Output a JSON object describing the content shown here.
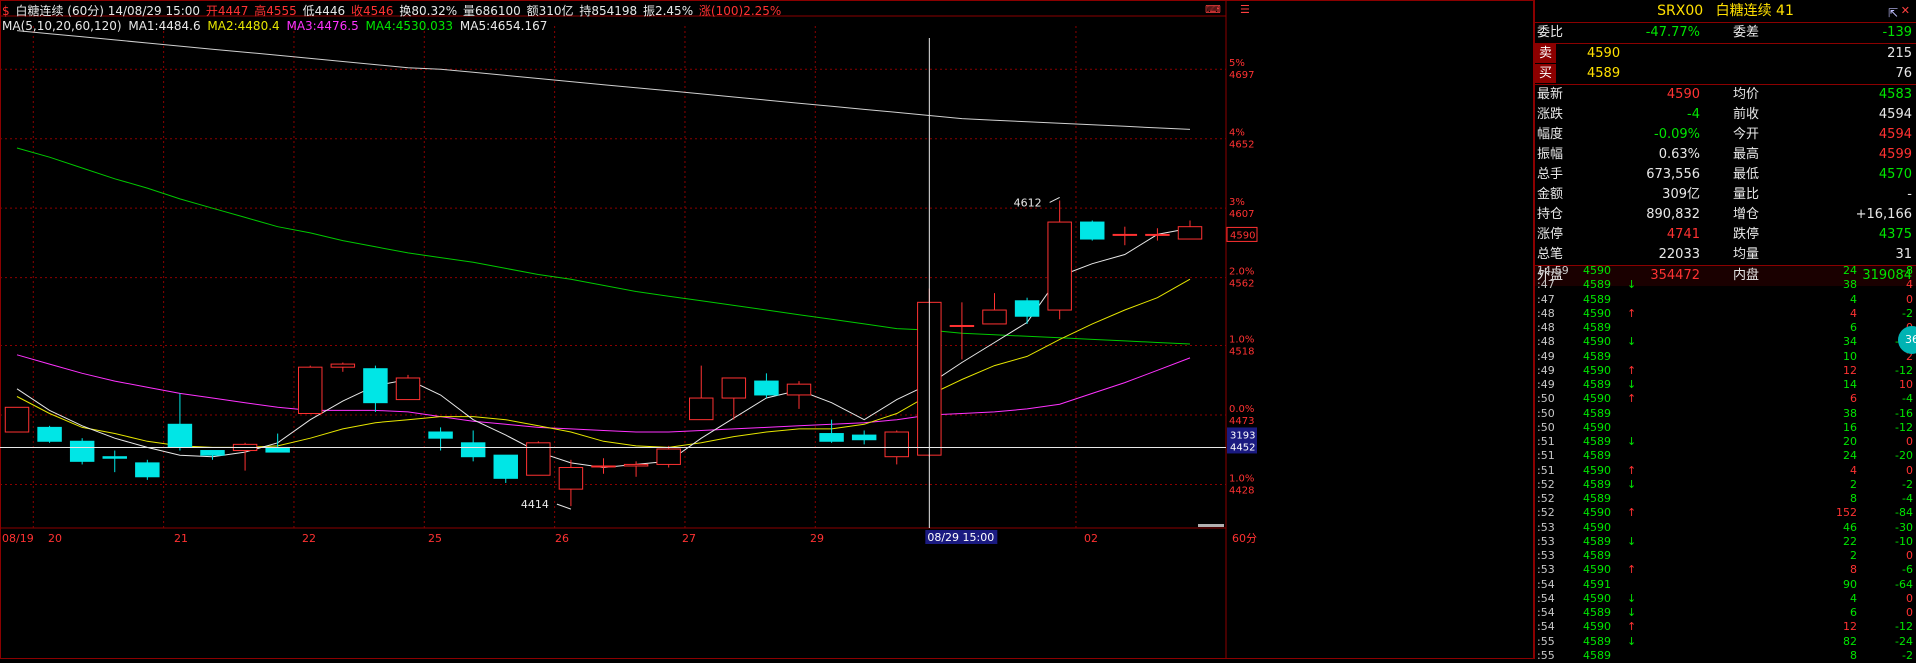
{
  "header": {
    "dollar": "$",
    "title": "白糖连续 (60分) 14/08/29 15:00",
    "open": "开4447",
    "high": "高4555",
    "low": "低4446",
    "close": "收4546",
    "turnover_rate": "换80.32%",
    "volume": "量686100",
    "amount": "额310亿",
    "open_interest": "持854198",
    "amplitude": "振2.45%",
    "change": "涨(100)2.25%"
  },
  "ma_line": {
    "label": "MA(5,10,20,60,120)",
    "ma1": "MA1:4484.6",
    "ma2": "MA2:4480.4",
    "ma3": "MA3:4476.5",
    "ma4": "MA4:4530.033",
    "ma5": "MA5:4654.167"
  },
  "colors": {
    "up": "#ff3232",
    "down": "#00e6e6",
    "ma1": "#e8e8e8",
    "ma2": "#e6e600",
    "ma3": "#ff32ff",
    "ma4": "#00c800",
    "ma5": "#d0d0d0",
    "grid": "#8b0000"
  },
  "chart_data": {
    "type": "candlestick",
    "price_axis": {
      "labels": [
        "4697",
        "4652",
        "4607",
        "4562",
        "4518",
        "4473",
        "4428"
      ],
      "pct_labels": [
        "5%",
        "4%",
        "3%",
        "2.0%",
        "1.0%",
        "0.0%",
        "1.0%"
      ],
      "range": [
        4405,
        4725
      ]
    },
    "right_tags": {
      "current": "4590",
      "cursor_a": "3193",
      "cursor_b": "4452"
    },
    "x_labels": [
      "08/19",
      "20",
      "21",
      "22",
      "25",
      "26",
      "27",
      "29",
      "02",
      "60分"
    ],
    "cursor_label": "08/29 15:00",
    "annotations": [
      {
        "text": "4612",
        "price": 4612
      },
      {
        "text": "4414",
        "price": 4414
      }
    ],
    "candles": [
      {
        "o": 4462,
        "h": 4478,
        "l": 4462,
        "c": 4478
      },
      {
        "o": 4465,
        "h": 4466,
        "l": 4455,
        "c": 4456
      },
      {
        "o": 4456,
        "h": 4458,
        "l": 4441,
        "c": 4443
      },
      {
        "o": 4446,
        "h": 4450,
        "l": 4436,
        "c": 4445
      },
      {
        "o": 4442,
        "h": 4444,
        "l": 4431,
        "c": 4433
      },
      {
        "o": 4467,
        "h": 4487,
        "l": 4450,
        "c": 4452
      },
      {
        "o": 4450,
        "h": 4450,
        "l": 4444,
        "c": 4447
      },
      {
        "o": 4450,
        "h": 4455,
        "l": 4437,
        "c": 4454
      },
      {
        "o": 4452,
        "h": 4461,
        "l": 4449,
        "c": 4449
      },
      {
        "o": 4474,
        "h": 4505,
        "l": 4474,
        "c": 4504
      },
      {
        "o": 4504,
        "h": 4507,
        "l": 4501,
        "c": 4506
      },
      {
        "o": 4503,
        "h": 4505,
        "l": 4475,
        "c": 4481
      },
      {
        "o": 4483,
        "h": 4499,
        "l": 4483,
        "c": 4497
      },
      {
        "o": 4462,
        "h": 4465,
        "l": 4450,
        "c": 4458
      },
      {
        "o": 4455,
        "h": 4463,
        "l": 4443,
        "c": 4446
      },
      {
        "o": 4447,
        "h": 4447,
        "l": 4429,
        "c": 4432
      },
      {
        "o": 4434,
        "h": 4456,
        "l": 4434,
        "c": 4455
      },
      {
        "o": 4425,
        "h": 4444,
        "l": 4414,
        "c": 4439
      },
      {
        "o": 4440,
        "h": 4445,
        "l": 4435,
        "c": 4440
      },
      {
        "o": 4440,
        "h": 4443,
        "l": 4433,
        "c": 4441
      },
      {
        "o": 4441,
        "h": 4453,
        "l": 4439,
        "c": 4451
      },
      {
        "o": 4470,
        "h": 4505,
        "l": 4470,
        "c": 4484
      },
      {
        "o": 4484,
        "h": 4491,
        "l": 4470,
        "c": 4497
      },
      {
        "o": 4495,
        "h": 4500,
        "l": 4484,
        "c": 4486
      },
      {
        "o": 4486,
        "h": 4495,
        "l": 4477,
        "c": 4493
      },
      {
        "o": 4461,
        "h": 4470,
        "l": 4455,
        "c": 4456
      },
      {
        "o": 4460,
        "h": 4463,
        "l": 4454,
        "c": 4457
      },
      {
        "o": 4446,
        "h": 4463,
        "l": 4441,
        "c": 4462
      },
      {
        "o": 4447,
        "h": 4555,
        "l": 4446,
        "c": 4546
      },
      {
        "o": 4531,
        "h": 4546,
        "l": 4509,
        "c": 4531
      },
      {
        "o": 4532,
        "h": 4552,
        "l": 4532,
        "c": 4541
      },
      {
        "o": 4547,
        "h": 4549,
        "l": 4532,
        "c": 4537
      },
      {
        "o": 4541,
        "h": 4612,
        "l": 4535,
        "c": 4598
      },
      {
        "o": 4598,
        "h": 4599,
        "l": 4586,
        "c": 4587
      },
      {
        "o": 4590,
        "h": 4595,
        "l": 4583,
        "c": 4590
      },
      {
        "o": 4590,
        "h": 4594,
        "l": 4586,
        "c": 4590
      },
      {
        "o": 4587,
        "h": 4599,
        "l": 4587,
        "c": 4595
      }
    ],
    "ma_series": {
      "ma1": [
        4490,
        4476,
        4466,
        4458,
        4452,
        4447,
        4446,
        4449,
        4455,
        4470,
        4482,
        4492,
        4496,
        4486,
        4470,
        4460,
        4449,
        4442,
        4439,
        4441,
        4443,
        4458,
        4471,
        4484,
        4489,
        4481,
        4470,
        4483,
        4493,
        4507,
        4520,
        4533,
        4563,
        4571,
        4577,
        4590,
        4594
      ],
      "ma2": [
        4485,
        4474,
        4465,
        4461,
        4456,
        4453,
        4452,
        4452,
        4453,
        4458,
        4464,
        4468,
        4470,
        4472,
        4472,
        4470,
        4466,
        4462,
        4456,
        4453,
        4452,
        4455,
        4459,
        4462,
        4464,
        4464,
        4467,
        4474,
        4486,
        4496,
        4505,
        4511,
        4522,
        4532,
        4541,
        4549,
        4561
      ],
      "ma3": [
        4512,
        4506,
        4500,
        4495,
        4491,
        4487,
        4484,
        4481,
        4478,
        4476,
        4476,
        4476,
        4475,
        4472,
        4469,
        4467,
        4465,
        4464,
        4463,
        4462,
        4462,
        4463,
        4464,
        4465,
        4466,
        4467,
        4468,
        4470,
        4473,
        4474,
        4475,
        4477,
        4480,
        4487,
        4494,
        4502,
        4510
      ],
      "ma4": [
        4646,
        4640,
        4633,
        4626,
        4620,
        4613,
        4607,
        4601,
        4595,
        4591,
        4586,
        4582,
        4578,
        4575,
        4572,
        4568,
        4564,
        4561,
        4557,
        4553,
        4550,
        4547,
        4544,
        4541,
        4538,
        4535,
        4532,
        4529,
        4528,
        4526,
        4525,
        4524,
        4523,
        4522,
        4521,
        4520,
        4519
      ],
      "ma5": [
        4722,
        4720,
        4718,
        4716,
        4714,
        4712,
        4710,
        4708,
        4706,
        4704,
        4702,
        4700,
        4698,
        4697,
        4695,
        4693,
        4691,
        4689,
        4687,
        4685,
        4683,
        4681,
        4679,
        4677,
        4675,
        4673,
        4671,
        4669,
        4667,
        4665,
        4664,
        4663,
        4662,
        4661,
        4660,
        4659,
        4658
      ]
    }
  },
  "panel": {
    "title_code": "SRX00",
    "title_name": "白糖连续",
    "title_num": "41",
    "weibi": {
      "k": "委比",
      "v": "-47.77%",
      "k2": "委差",
      "v2": "-139"
    },
    "sell": {
      "k": "卖",
      "price": "4590",
      "qty": "215"
    },
    "buy": {
      "k": "买",
      "price": "4589",
      "qty": "76"
    },
    "stats": [
      {
        "k": "最新",
        "v": "4590",
        "k2": "均价",
        "v2": "4583",
        "c1": "red",
        "c2": "grn"
      },
      {
        "k": "涨跌",
        "v": "-4",
        "k2": "前收",
        "v2": "4594",
        "c1": "grn",
        "c2": "wht"
      },
      {
        "k": "幅度",
        "v": "-0.09%",
        "k2": "今开",
        "v2": "4594",
        "c1": "grn",
        "c2": "red"
      },
      {
        "k": "振幅",
        "v": "0.63%",
        "k2": "最高",
        "v2": "4599",
        "c1": "wht",
        "c2": "red"
      },
      {
        "k": "总手",
        "v": "673,556",
        "k2": "最低",
        "v2": "4570",
        "c1": "wht",
        "c2": "grn"
      },
      {
        "k": "金额",
        "v": "309亿",
        "k2": "量比",
        "v2": "-",
        "c1": "wht",
        "c2": "wht"
      },
      {
        "k": "持仓",
        "v": "890,832",
        "k2": "增仓",
        "v2": "+16,166",
        "c1": "wht",
        "c2": "wht"
      },
      {
        "k": "涨停",
        "v": "4741",
        "k2": "跌停",
        "v2": "4375",
        "c1": "red",
        "c2": "grn"
      },
      {
        "k": "总笔",
        "v": "22033",
        "k2": "均量",
        "v2": "31",
        "c1": "wht",
        "c2": "wht"
      },
      {
        "k": "外盘",
        "v": "354472",
        "k2": "内盘",
        "v2": "319084",
        "c1": "red",
        "c2": "grn"
      }
    ],
    "badge": "36"
  },
  "ticks": [
    {
      "t": "14:59",
      "p": "4590",
      "a": "",
      "v": "24",
      "c": "-8",
      "pc": "grn"
    },
    {
      "t": ":47",
      "p": "4589",
      "a": "↓",
      "v": "38",
      "c": "4",
      "pc": "grn"
    },
    {
      "t": ":47",
      "p": "4589",
      "a": "",
      "v": "4",
      "c": "0",
      "pc": "grn"
    },
    {
      "t": ":48",
      "p": "4590",
      "a": "↑",
      "v": "4",
      "c": "-2",
      "pc": "grn"
    },
    {
      "t": ":48",
      "p": "4589",
      "a": "",
      "v": "6",
      "c": "0",
      "pc": "grn"
    },
    {
      "t": ":48",
      "p": "4590",
      "a": "↓",
      "v": "34",
      "c": "-12",
      "pc": "grn"
    },
    {
      "t": ":49",
      "p": "4589",
      "a": "",
      "v": "10",
      "c": "2",
      "pc": "grn"
    },
    {
      "t": ":49",
      "p": "4590",
      "a": "↑",
      "v": "12",
      "c": "-12",
      "pc": "grn"
    },
    {
      "t": ":49",
      "p": "4589",
      "a": "↓",
      "v": "14",
      "c": "10",
      "pc": "grn"
    },
    {
      "t": ":50",
      "p": "4590",
      "a": "↑",
      "v": "6",
      "c": "-4",
      "pc": "grn"
    },
    {
      "t": ":50",
      "p": "4589",
      "a": "",
      "v": "38",
      "c": "-16",
      "pc": "grn"
    },
    {
      "t": ":50",
      "p": "4590",
      "a": "",
      "v": "16",
      "c": "-12",
      "pc": "grn"
    },
    {
      "t": ":51",
      "p": "4589",
      "a": "↓",
      "v": "20",
      "c": "0",
      "pc": "grn"
    },
    {
      "t": ":51",
      "p": "4589",
      "a": "",
      "v": "24",
      "c": "-20",
      "pc": "grn"
    },
    {
      "t": ":51",
      "p": "4590",
      "a": "↑",
      "v": "4",
      "c": "0",
      "pc": "grn"
    },
    {
      "t": ":52",
      "p": "4589",
      "a": "↓",
      "v": "2",
      "c": "-2",
      "pc": "grn"
    },
    {
      "t": ":52",
      "p": "4589",
      "a": "",
      "v": "8",
      "c": "-4",
      "pc": "grn"
    },
    {
      "t": ":52",
      "p": "4590",
      "a": "↑",
      "v": "152",
      "c": "-84",
      "pc": "grn"
    },
    {
      "t": ":53",
      "p": "4590",
      "a": "",
      "v": "46",
      "c": "-30",
      "pc": "grn"
    },
    {
      "t": ":53",
      "p": "4589",
      "a": "↓",
      "v": "22",
      "c": "-10",
      "pc": "grn"
    },
    {
      "t": ":53",
      "p": "4589",
      "a": "",
      "v": "2",
      "c": "0",
      "pc": "grn"
    },
    {
      "t": ":53",
      "p": "4590",
      "a": "↑",
      "v": "8",
      "c": "-6",
      "pc": "grn"
    },
    {
      "t": ":54",
      "p": "4591",
      "a": "",
      "v": "90",
      "c": "-64",
      "pc": "grn"
    },
    {
      "t": ":54",
      "p": "4590",
      "a": "↓",
      "v": "4",
      "c": "0",
      "pc": "grn"
    },
    {
      "t": ":54",
      "p": "4589",
      "a": "↓",
      "v": "6",
      "c": "0",
      "pc": "grn"
    },
    {
      "t": ":54",
      "p": "4590",
      "a": "↑",
      "v": "12",
      "c": "-12",
      "pc": "grn"
    },
    {
      "t": ":55",
      "p": "4589",
      "a": "↓",
      "v": "82",
      "c": "-24",
      "pc": "grn"
    },
    {
      "t": ":55",
      "p": "4589",
      "a": "",
      "v": "8",
      "c": "-2",
      "pc": "grn"
    }
  ]
}
